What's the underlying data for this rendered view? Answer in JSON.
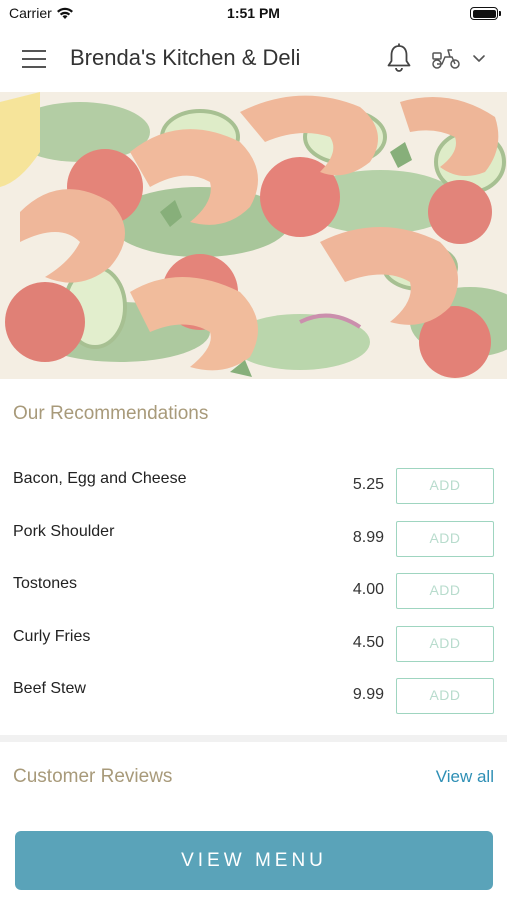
{
  "status": {
    "carrier": "Carrier",
    "time": "1:51 PM"
  },
  "header": {
    "title": "Brenda's Kitchen & Deli",
    "icons": [
      "menu-icon",
      "bell-icon",
      "scooter-icon",
      "chevron-down-icon"
    ]
  },
  "hero": {
    "image": "shrimp-salad-photo"
  },
  "recommendations": {
    "title": "Our Recommendations",
    "items": [
      {
        "name": "Bacon, Egg and Cheese",
        "price": "5.25",
        "button": "ADD"
      },
      {
        "name": "Pork Shoulder",
        "price": "8.99",
        "button": "ADD"
      },
      {
        "name": "Tostones",
        "price": "4.00",
        "button": "ADD"
      },
      {
        "name": "Curly Fries",
        "price": "4.50",
        "button": "ADD"
      },
      {
        "name": "Beef Stew",
        "price": "9.99",
        "button": "ADD"
      }
    ]
  },
  "reviews": {
    "title": "Customer Reviews",
    "link": "View all"
  },
  "footer": {
    "cta": "VIEW MENU"
  },
  "colors": {
    "accent_title": "#a89a7a",
    "add_border": "#9fd5c0",
    "link": "#2e8fb5",
    "cta_bg": "#5aa3b9"
  }
}
